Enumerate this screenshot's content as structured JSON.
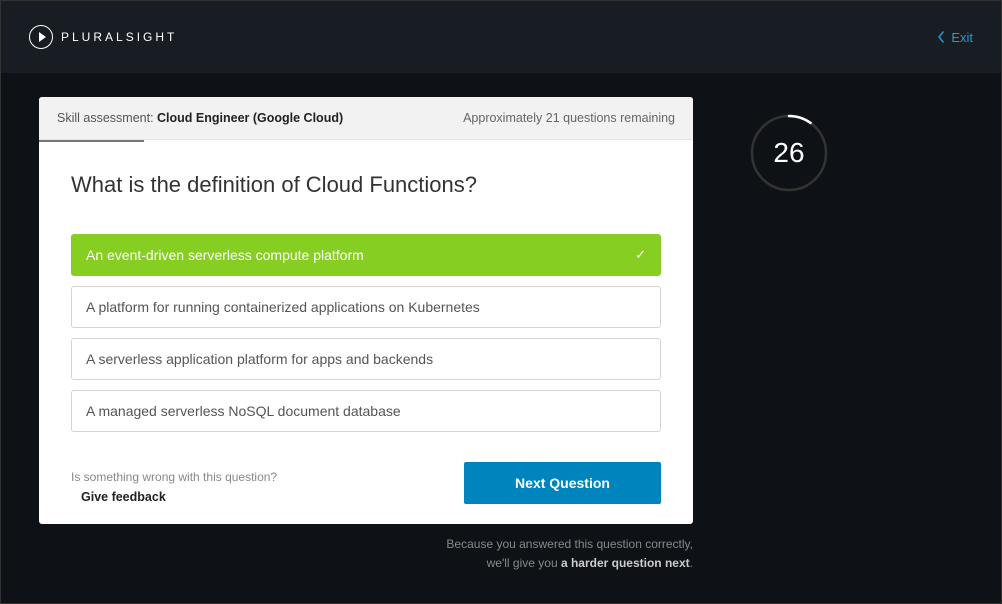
{
  "header": {
    "brand": "PLURALSIGHT",
    "exit_label": "Exit"
  },
  "panel": {
    "header": {
      "prefix": "Skill assessment: ",
      "name": "Cloud Engineer (Google Cloud)",
      "remaining": "Approximately 21 questions remaining"
    },
    "question": "What is the definition of Cloud Functions?",
    "answers": [
      {
        "text": "An event-driven serverless compute platform",
        "selected": true
      },
      {
        "text": "A platform for running containerized applications on Kubernetes",
        "selected": false
      },
      {
        "text": "A serverless application platform for apps and backends",
        "selected": false
      },
      {
        "text": "A managed serverless NoSQL document database",
        "selected": false
      }
    ],
    "feedback": {
      "prompt": "Is something wrong with this question?",
      "link": "Give feedback"
    },
    "next_label": "Next Question"
  },
  "timer": {
    "value": "26"
  },
  "bottom": {
    "line1": "Because you answered this question correctly,",
    "line2_prefix": "we'll give you ",
    "line2_bold": "a harder question next",
    "line2_suffix": "."
  }
}
